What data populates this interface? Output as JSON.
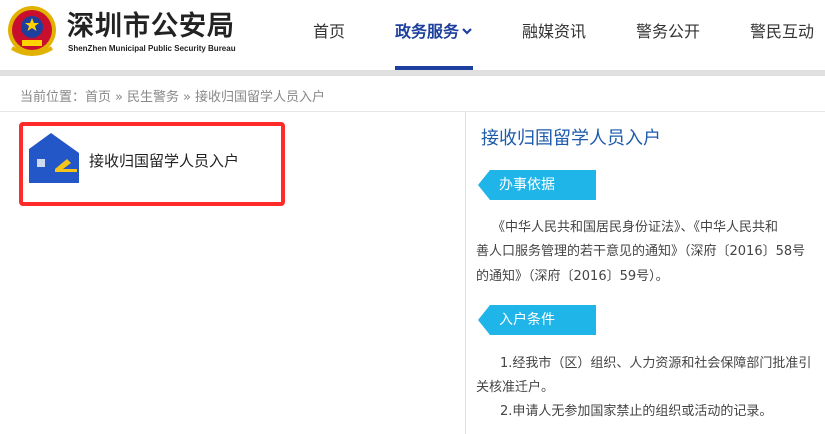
{
  "header": {
    "brand_cn": "深圳市公安局",
    "brand_en": "ShenZhen Municipal Public Security Bureau",
    "nav": [
      {
        "label": "首页",
        "active": false
      },
      {
        "label": "政务服务",
        "active": true,
        "has_dropdown": true
      },
      {
        "label": "融媒资讯",
        "active": false
      },
      {
        "label": "警务公开",
        "active": false
      },
      {
        "label": "警民互动",
        "active": false
      }
    ]
  },
  "breadcrumb": {
    "prefix": "当前位置：",
    "items": [
      "首页",
      "民生警务",
      "接收归国留学人员入户"
    ],
    "separator": "»"
  },
  "service": {
    "label": "接收归国留学人员入户",
    "icon": "house-icon"
  },
  "detail": {
    "title": "接收归国留学人员入户",
    "basis_tag": "办事依据",
    "basis_lines": [
      "《中华人民共和国居民身份证法》、《中华人民共和",
      "善人口服务管理的若干意见的通知》（深府〔2016〕58号",
      "的通知》（深府〔2016〕59号）。"
    ],
    "conditions_tag": "入户条件",
    "conditions_lines": [
      "1.经我市（区）组织、人力资源和社会保障部门批准引",
      "关核准迁户。",
      "2.申请人无参加国家禁止的组织或活动的记录。"
    ]
  },
  "colors": {
    "accent": "#1d3f9e",
    "tag": "#1fb5e9",
    "title": "#1e5bab",
    "highlight": "#ff2a2a"
  }
}
